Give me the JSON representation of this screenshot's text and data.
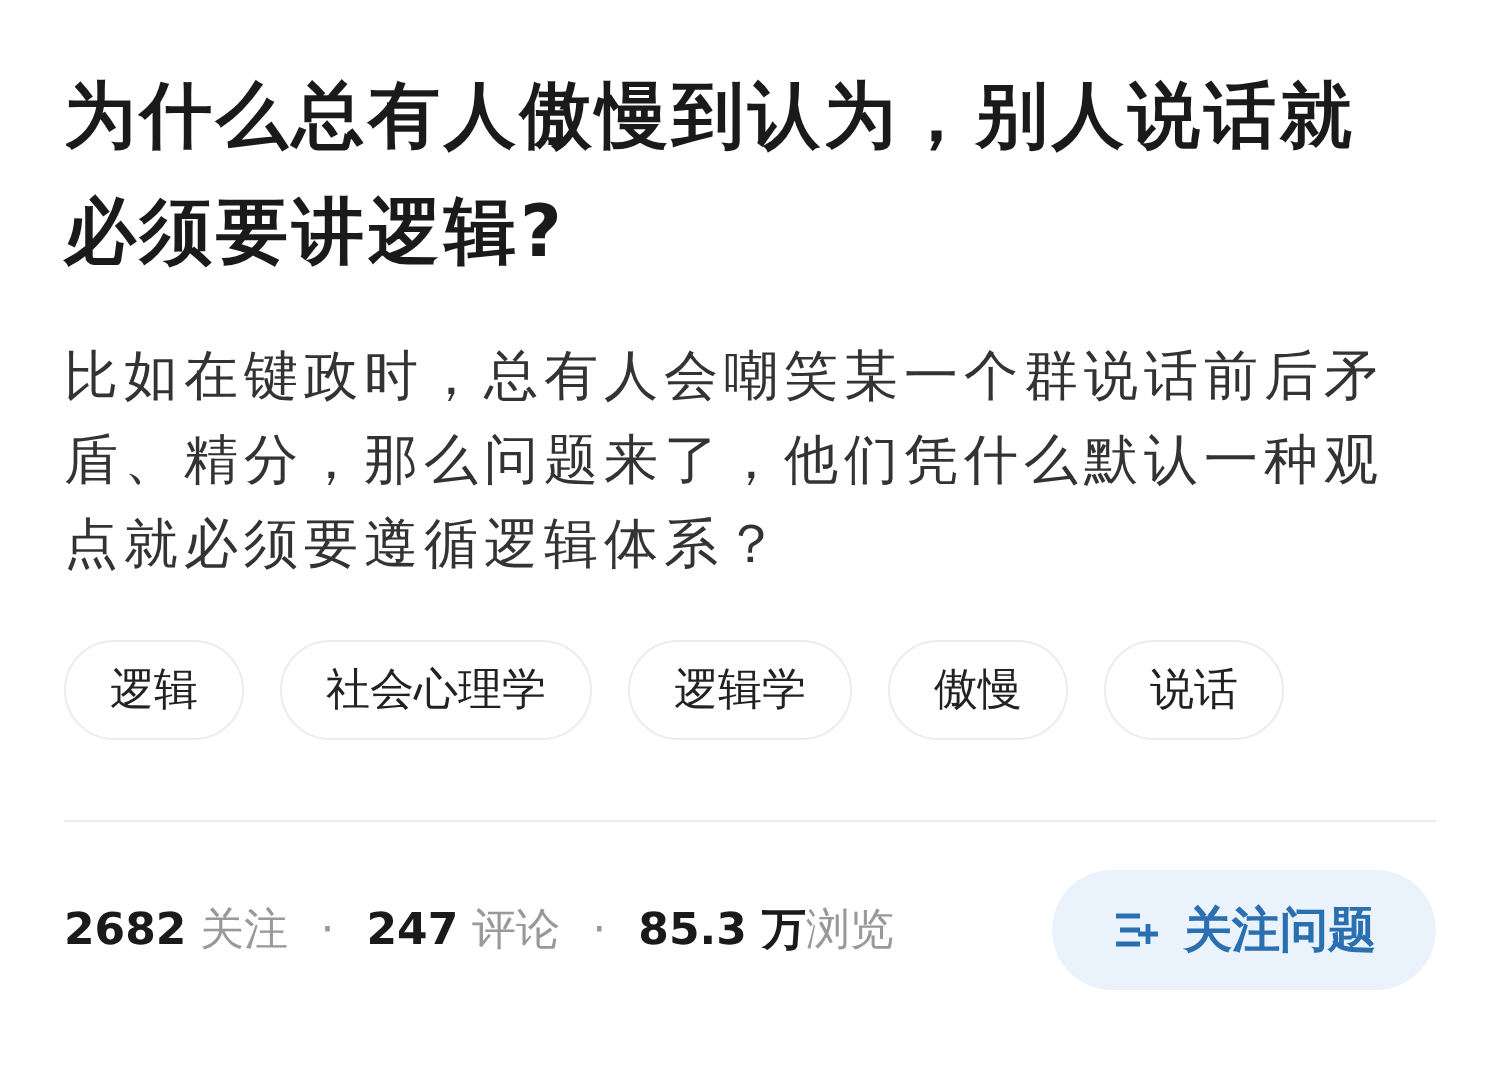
{
  "question": {
    "title": "为什么总有人傲慢到认为，别人说话就必须要讲逻辑?",
    "description": "比如在键政时，总有人会嘲笑某一个群说话前后矛盾、精分，那么问题来了，他们凭什么默认一种观点就必须要遵循逻辑体系？"
  },
  "tags": [
    "逻辑",
    "社会心理学",
    "逻辑学",
    "傲慢",
    "说话"
  ],
  "stats": [
    {
      "kind": "stat",
      "text": "**2682** 关注"
    },
    {
      "kind": "dot",
      "text": "·"
    },
    {
      "kind": "stat",
      "text": "**247** 评论"
    },
    {
      "kind": "dot",
      "text": "·"
    },
    {
      "kind": "stat",
      "text": "**85.3 万**浏览"
    }
  ],
  "follow_button": {
    "label": "关注问题"
  }
}
